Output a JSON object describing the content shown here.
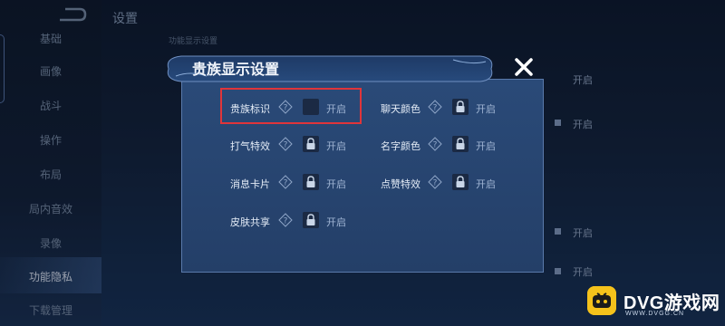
{
  "top_bar": {
    "title": "设置"
  },
  "subheader": "功能显示设置",
  "sidebar": {
    "items": [
      {
        "label": "基础"
      },
      {
        "label": "画像"
      },
      {
        "label": "战斗"
      },
      {
        "label": "操作"
      },
      {
        "label": "布局"
      },
      {
        "label": "局内音效"
      },
      {
        "label": "录像"
      },
      {
        "label": "功能隐私"
      },
      {
        "label": "下载管理"
      }
    ],
    "active_index": 7
  },
  "background_options": [
    "开启",
    "开启",
    "开启",
    "开启"
  ],
  "dialog": {
    "title": "贵族显示设置",
    "options": [
      {
        "label": "贵族标识",
        "state_label": "开启",
        "locked": false
      },
      {
        "label": "聊天颜色",
        "state_label": "开启",
        "locked": true
      },
      {
        "label": "打气特效",
        "state_label": "开启",
        "locked": true
      },
      {
        "label": "名字颜色",
        "state_label": "开启",
        "locked": true
      },
      {
        "label": "消息卡片",
        "state_label": "开启",
        "locked": true
      },
      {
        "label": "点赞特效",
        "state_label": "开启",
        "locked": true
      },
      {
        "label": "皮肤共享",
        "state_label": "开启",
        "locked": true
      }
    ]
  },
  "watermark": {
    "brand": "DVG游戏网",
    "url": "WWW.DVGG.CN",
    "badge_color": "#f5c21b"
  },
  "colors": {
    "highlight": "#e0353a",
    "dialog_bg": "#243f68",
    "accent": "#5a7aab"
  }
}
